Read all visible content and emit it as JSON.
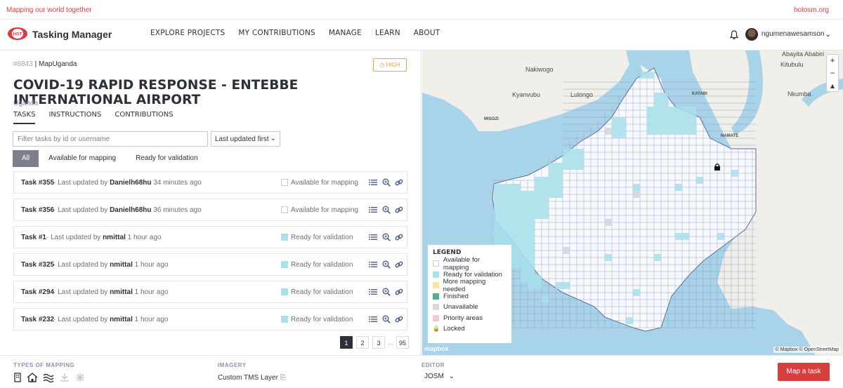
{
  "topstrip": {
    "tagline": "Mapping our world together",
    "site": "hotosm.org"
  },
  "header": {
    "brand": "Tasking Manager",
    "nav": [
      "EXPLORE PROJECTS",
      "MY CONTRIBUTIONS",
      "MANAGE",
      "LEARN",
      "ABOUT"
    ],
    "username": "ngumenawesamson"
  },
  "project": {
    "id": "#8843",
    "org": "MapUganda",
    "priority": "HIGH",
    "title": "COVID-19 RAPID RESPONSE - ENTEBBE INTERNATIONAL AIRPORT",
    "country": "Uganda",
    "tabs": [
      "TASKS",
      "INSTRUCTIONS",
      "CONTRIBUTIONS"
    ]
  },
  "filter": {
    "placeholder": "Filter tasks by id or username",
    "sort": "Last updated first",
    "status_filters": [
      "All",
      "Available for mapping",
      "Ready for validation"
    ]
  },
  "tasks": [
    {
      "name": "Task #355",
      "prefix": "Last updated by",
      "user": "Danielh68hu",
      "time": "34 minutes ago",
      "status": "Available for mapping",
      "state": "avail"
    },
    {
      "name": "Task #356",
      "prefix": "Last updated by",
      "user": "Danielh68hu",
      "time": "36 minutes ago",
      "status": "Available for mapping",
      "state": "avail"
    },
    {
      "name": "Task #1",
      "prefix": "Last updated by",
      "user": "nmittal",
      "time": "1 hour ago",
      "status": "Ready for validation",
      "state": "ready"
    },
    {
      "name": "Task #325",
      "prefix": "Last updated by",
      "user": "nmittal",
      "time": "1 hour ago",
      "status": "Ready for validation",
      "state": "ready"
    },
    {
      "name": "Task #294",
      "prefix": "Last updated by",
      "user": "nmittal",
      "time": "1 hour ago",
      "status": "Ready for validation",
      "state": "ready"
    },
    {
      "name": "Task #232",
      "prefix": "Last updated by",
      "user": "nmittal",
      "time": "1 hour ago",
      "status": "Ready for validation",
      "state": "ready"
    }
  ],
  "pagination": {
    "pages": [
      "1",
      "2",
      "3"
    ],
    "ellipsis": "...",
    "last": "95"
  },
  "footer": {
    "types_label": "TYPES OF MAPPING",
    "imagery_label": "IMAGERY",
    "imagery_value": "Custom TMS Layer",
    "editor_label": "EDITOR",
    "editor_value": "JOSM",
    "map_button": "Map a task"
  },
  "map": {
    "legend_title": "LEGEND",
    "legend": [
      {
        "label": "Available for mapping",
        "color": "#ffffff"
      },
      {
        "label": "Ready for validation",
        "color": "#a8e1ec"
      },
      {
        "label": "More mapping needed",
        "color": "#fce5a0"
      },
      {
        "label": "Finished",
        "color": "#4fb18f"
      },
      {
        "label": "Unavailable",
        "color": "#d8dae3"
      },
      {
        "label": "Priority areas",
        "color": "#f2c9cc"
      },
      {
        "label": "Locked",
        "color": "lock-icon"
      }
    ],
    "places": [
      "Abayita Ababiri",
      "Kitubulu",
      "Nakiwogo",
      "Kyanvubu",
      "Lulongo",
      "Nkumba",
      "KATABI",
      "MISOZI",
      "NAMATE"
    ],
    "attribution": "© Mapbox © OpenStreetMap",
    "mapbox": "mapbox",
    "zoom_in": "+",
    "zoom_out": "−"
  }
}
